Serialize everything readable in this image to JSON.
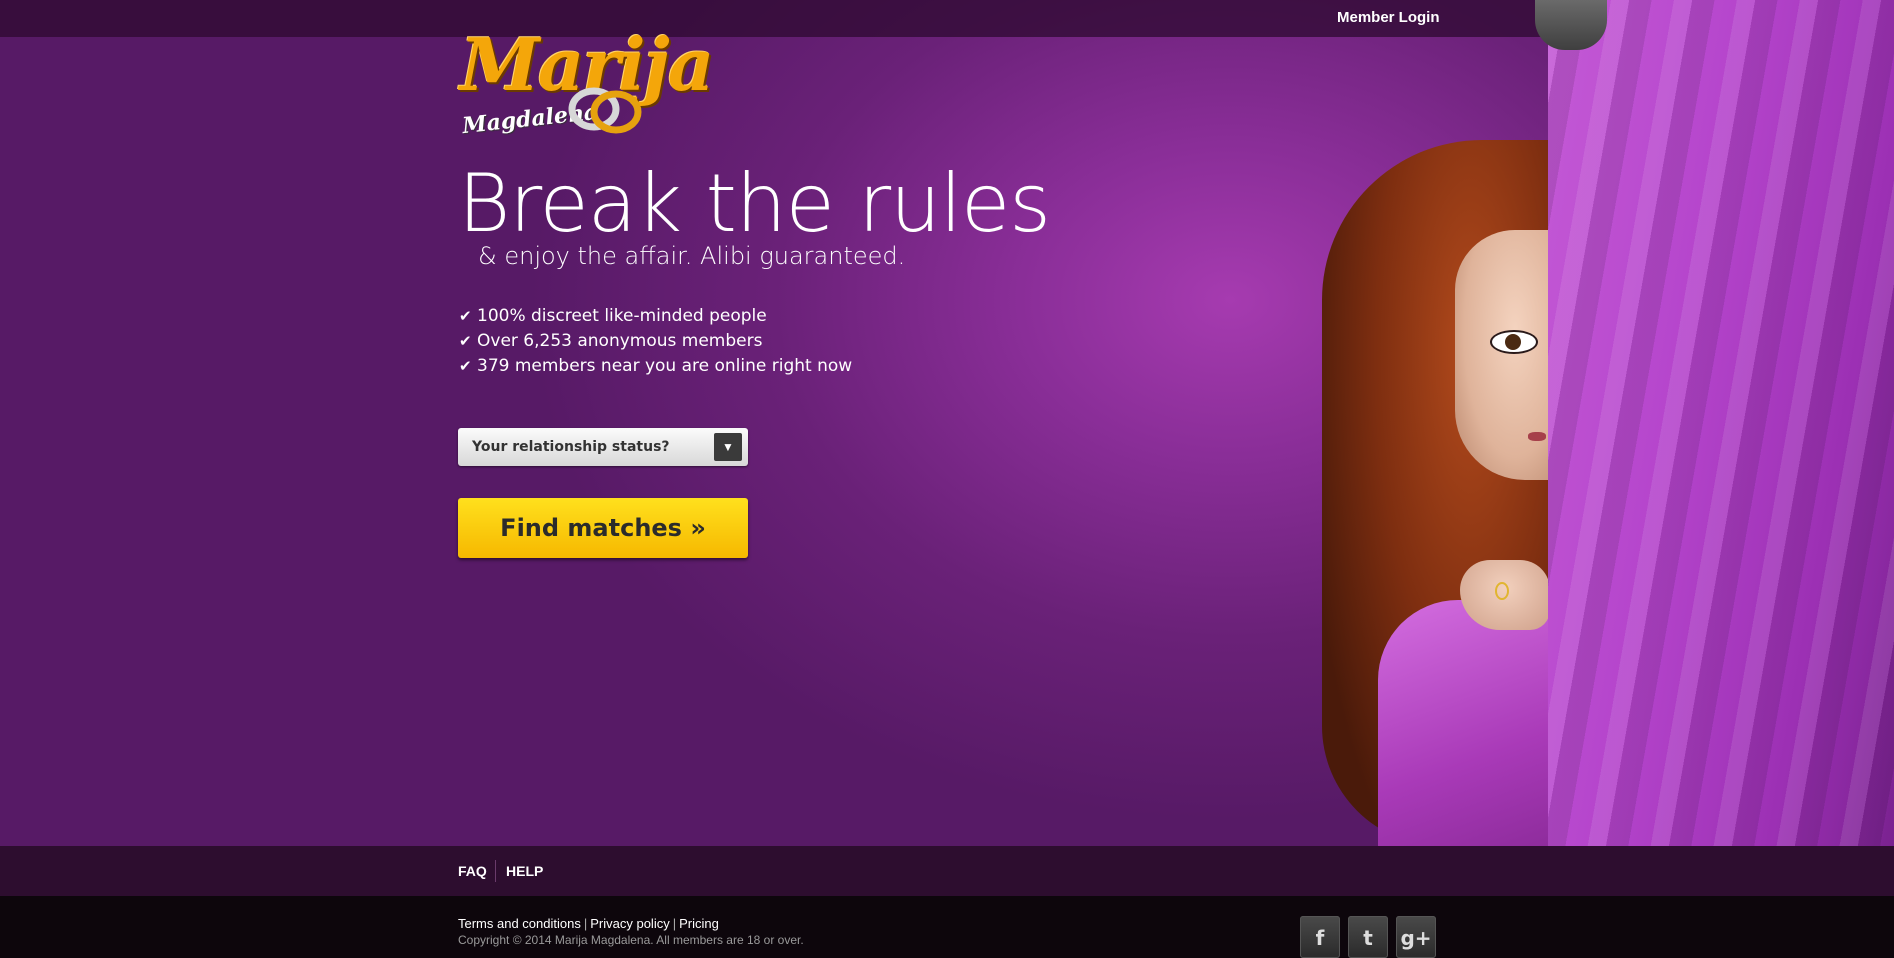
{
  "header": {
    "member_login": "Member Login"
  },
  "logo": {
    "name": "Marija",
    "subname": "Magdalena"
  },
  "hero": {
    "headline": "Break the rules",
    "tagline": "& enjoy the affair. Alibi guaranteed.",
    "benefits": [
      "100% discreet like-minded people",
      "Over 6,253 anonymous members",
      "379 members near you are online right now"
    ],
    "status_select": {
      "placeholder": "Your relationship status?"
    },
    "cta_label": "Find matches »"
  },
  "nav": {
    "faq": "FAQ",
    "help": "HELP"
  },
  "footer": {
    "terms": "Terms and conditions",
    "privacy": "Privacy policy",
    "pricing": "Pricing",
    "separator": "|",
    "copyright": "Copyright © 2014 Marija Magdalena. All members are 18 or over.",
    "social": {
      "facebook": "f",
      "twitter": "t",
      "google_plus": "g+"
    }
  },
  "icons": {
    "check": "check-icon",
    "caret": "chevron-down-icon",
    "facebook": "facebook-icon",
    "twitter": "twitter-icon",
    "google_plus": "google-plus-icon"
  },
  "colors": {
    "brand_purple": "#8a2e98",
    "cta_yellow": "#ffd21a",
    "topbar": "#2d0a30",
    "footer": "#0d060c"
  }
}
